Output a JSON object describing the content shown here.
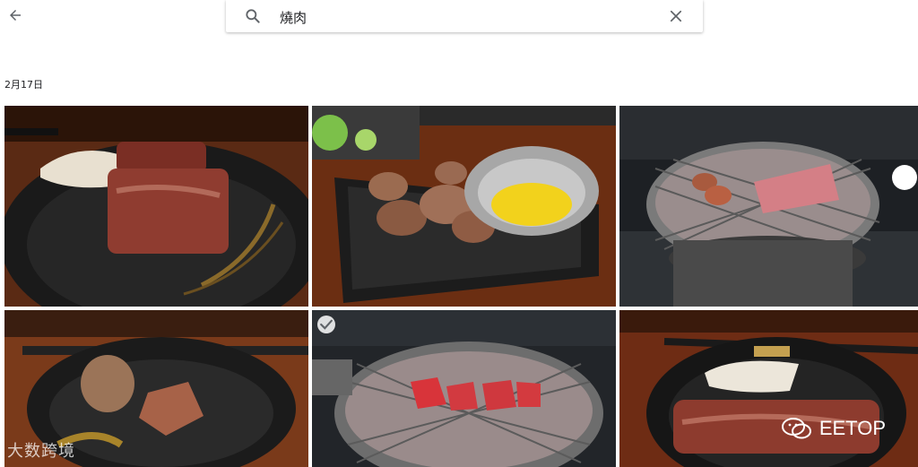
{
  "header": {
    "search_value": "燒肉"
  },
  "section": {
    "date": "2月17日"
  },
  "photos": [
    {
      "name": "photo-1"
    },
    {
      "name": "photo-2"
    },
    {
      "name": "photo-3"
    },
    {
      "name": "photo-4"
    },
    {
      "name": "photo-5"
    },
    {
      "name": "photo-6"
    }
  ],
  "watermarks": {
    "left": "大数跨境",
    "right": "EETOP"
  },
  "colors": {
    "accent": "#5f6368"
  }
}
